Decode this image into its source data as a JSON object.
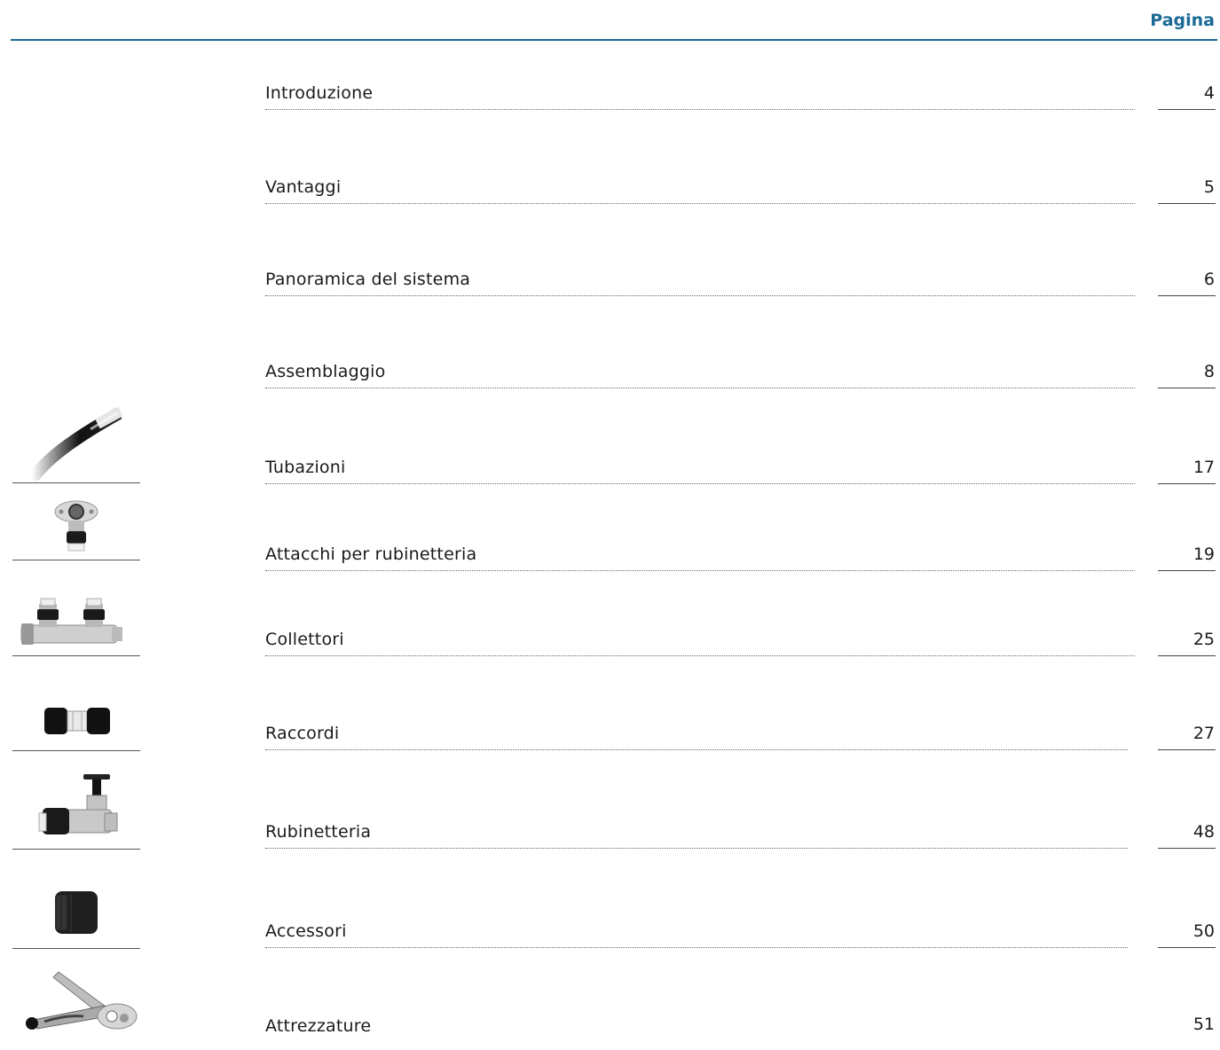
{
  "header": {
    "label": "Pagina",
    "accent_color": "#1b6a96"
  },
  "toc": [
    {
      "title": "Introduzione",
      "page": "4"
    },
    {
      "title": "Vantaggi",
      "page": "5"
    },
    {
      "title": "Panoramica del sistema",
      "page": "6"
    },
    {
      "title": "Assemblaggio",
      "page": "8"
    },
    {
      "title": "Tubazioni",
      "page": "17",
      "icon": "pipe-icon"
    },
    {
      "title": "Attacchi per rubinetteria",
      "page": "19",
      "icon": "wall-plate-fitting-icon"
    },
    {
      "title": "Collettori",
      "page": "25",
      "icon": "manifold-icon"
    },
    {
      "title": "Raccordi",
      "page": "27",
      "icon": "coupling-icon"
    },
    {
      "title": "Rubinetteria",
      "page": "48",
      "icon": "valve-icon"
    },
    {
      "title": "Accessori",
      "page": "50",
      "icon": "nut-icon"
    },
    {
      "title": "Attrezzature",
      "page": "51",
      "icon": "pipe-cutter-icon"
    }
  ]
}
